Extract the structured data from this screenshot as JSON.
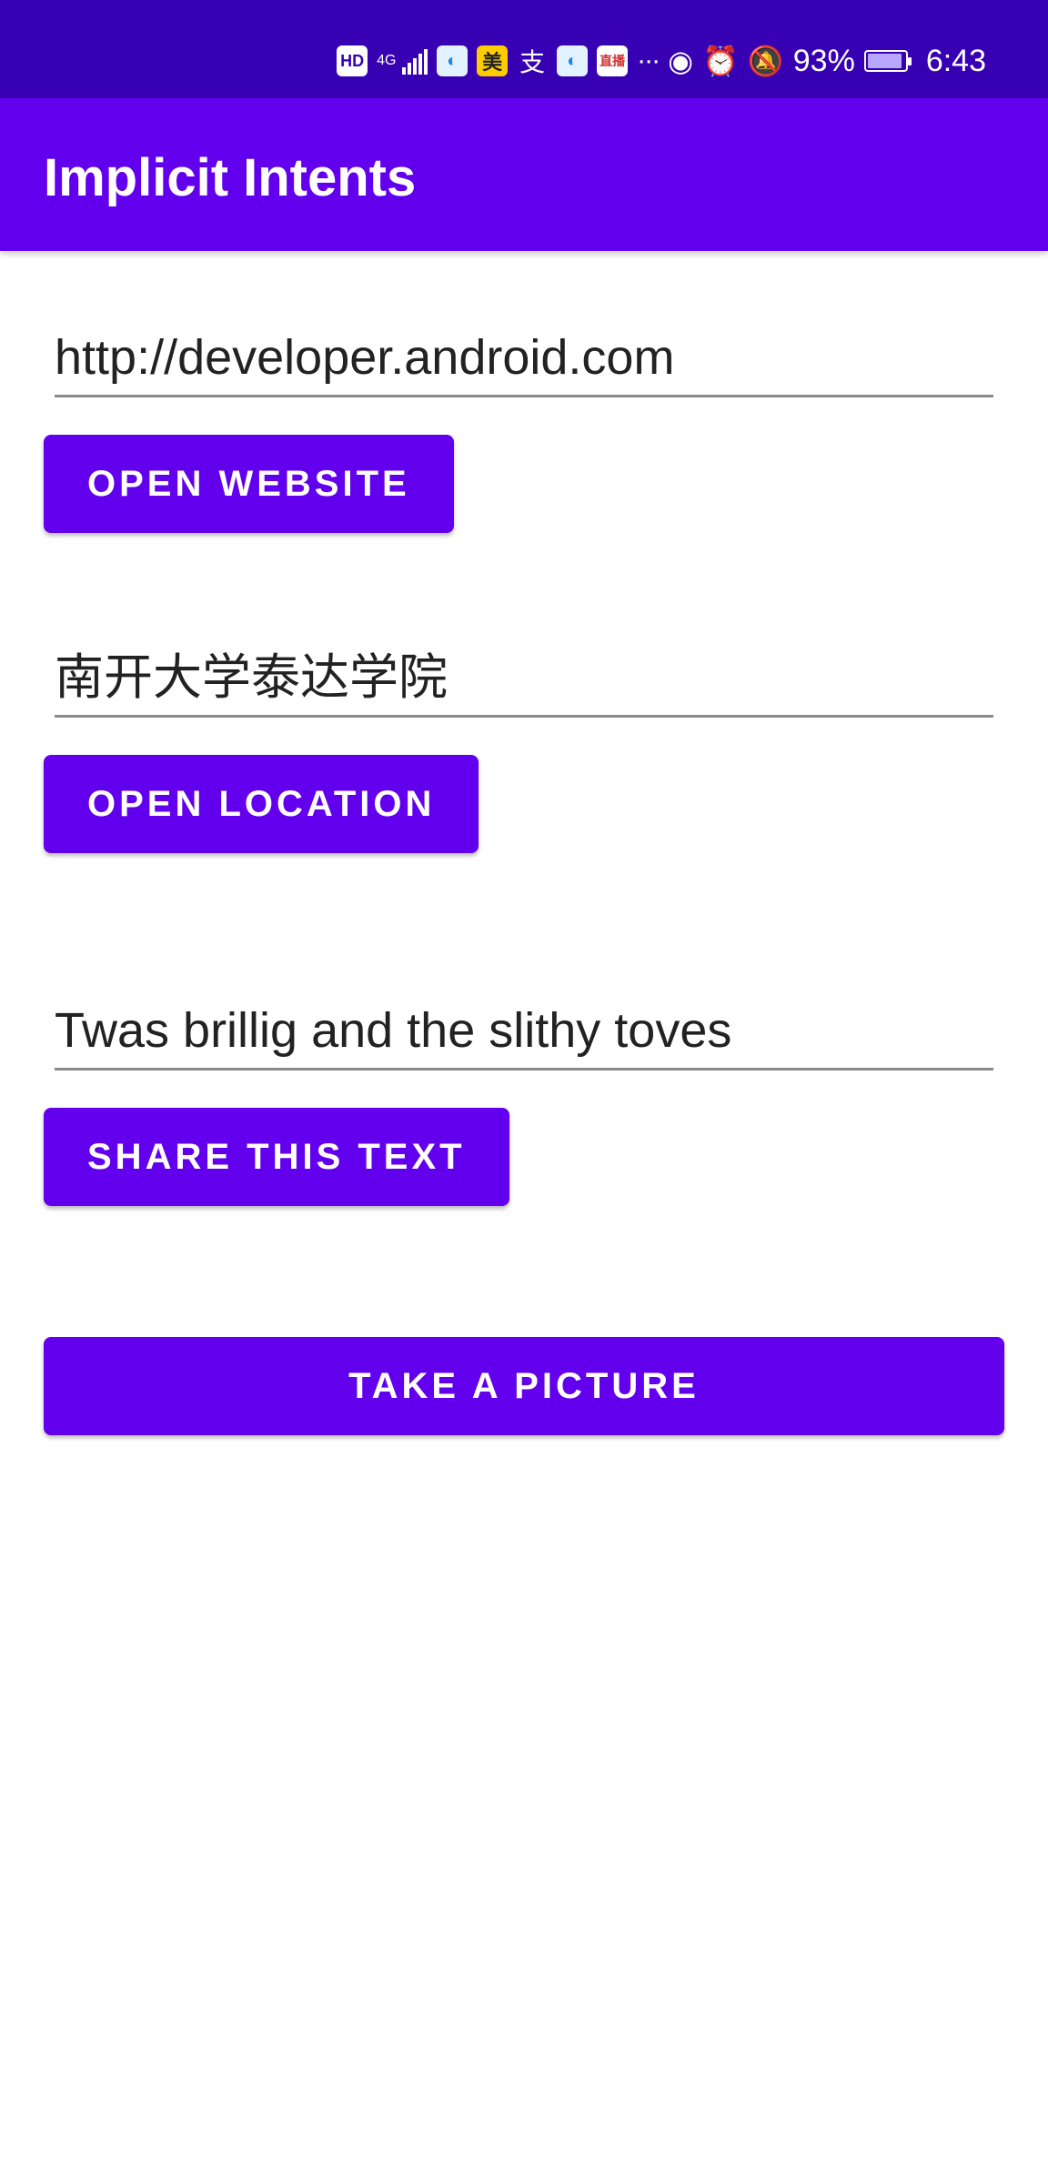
{
  "status_bar": {
    "hd_label": "HD",
    "network_label": "4G",
    "app_icon_2_label": "美",
    "app_icon_3_label": "支",
    "app_icon_5_label": "直播",
    "more_label": "···",
    "battery_percent": "93%",
    "battery_level": 0.93,
    "time": "6:43"
  },
  "app_bar": {
    "title": "Implicit Intents"
  },
  "website": {
    "value": "http://developer.android.com",
    "button_label": "OPEN WEBSITE"
  },
  "location": {
    "value": "南开大学泰达学院",
    "button_label": "OPEN LOCATION"
  },
  "share": {
    "value": "Twas brillig and the slithy toves",
    "button_label": "SHARE THIS TEXT"
  },
  "camera": {
    "button_label": "TAKE A PICTURE"
  },
  "colors": {
    "status_bar": "#3700b3",
    "primary": "#6200ee",
    "on_primary": "#ffffff"
  }
}
